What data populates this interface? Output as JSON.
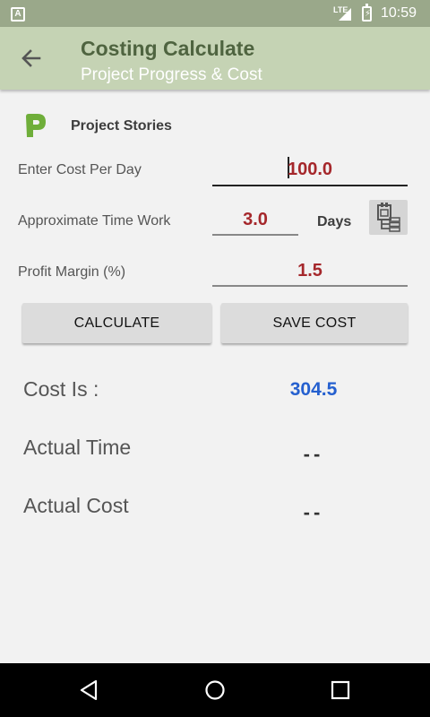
{
  "status_bar": {
    "app_badge": "A",
    "network": "LTE",
    "time": "10:59"
  },
  "app_bar": {
    "title": "Costing Calculate",
    "subtitle": "Project Progress & Cost",
    "back_icon": "arrow-back-icon"
  },
  "section": {
    "logo_icon": "project-stories-logo-icon",
    "title": "Project Stories"
  },
  "form": {
    "cost_per_day": {
      "label": "Enter Cost Per Day",
      "value": "100.0"
    },
    "time_work": {
      "label": "Approximate Time Work",
      "value": "3.0",
      "unit": "Days"
    },
    "profit_margin": {
      "label": "Profit Margin (%)",
      "value": "1.5"
    },
    "calendar_icon": "calendar-list-icon"
  },
  "buttons": {
    "calculate": "CALCULATE",
    "save": "SAVE COST"
  },
  "results": {
    "cost_label": "Cost Is :",
    "cost_value": "304.5",
    "time_label": "Actual Time",
    "time_value": "--",
    "actual_cost_label": "Actual Cost",
    "actual_cost_value": "--"
  },
  "colors": {
    "header_bg": "#c5d3b4",
    "title_color": "#4f6440",
    "input_value": "#a5272b",
    "result_value": "#2560cf"
  }
}
